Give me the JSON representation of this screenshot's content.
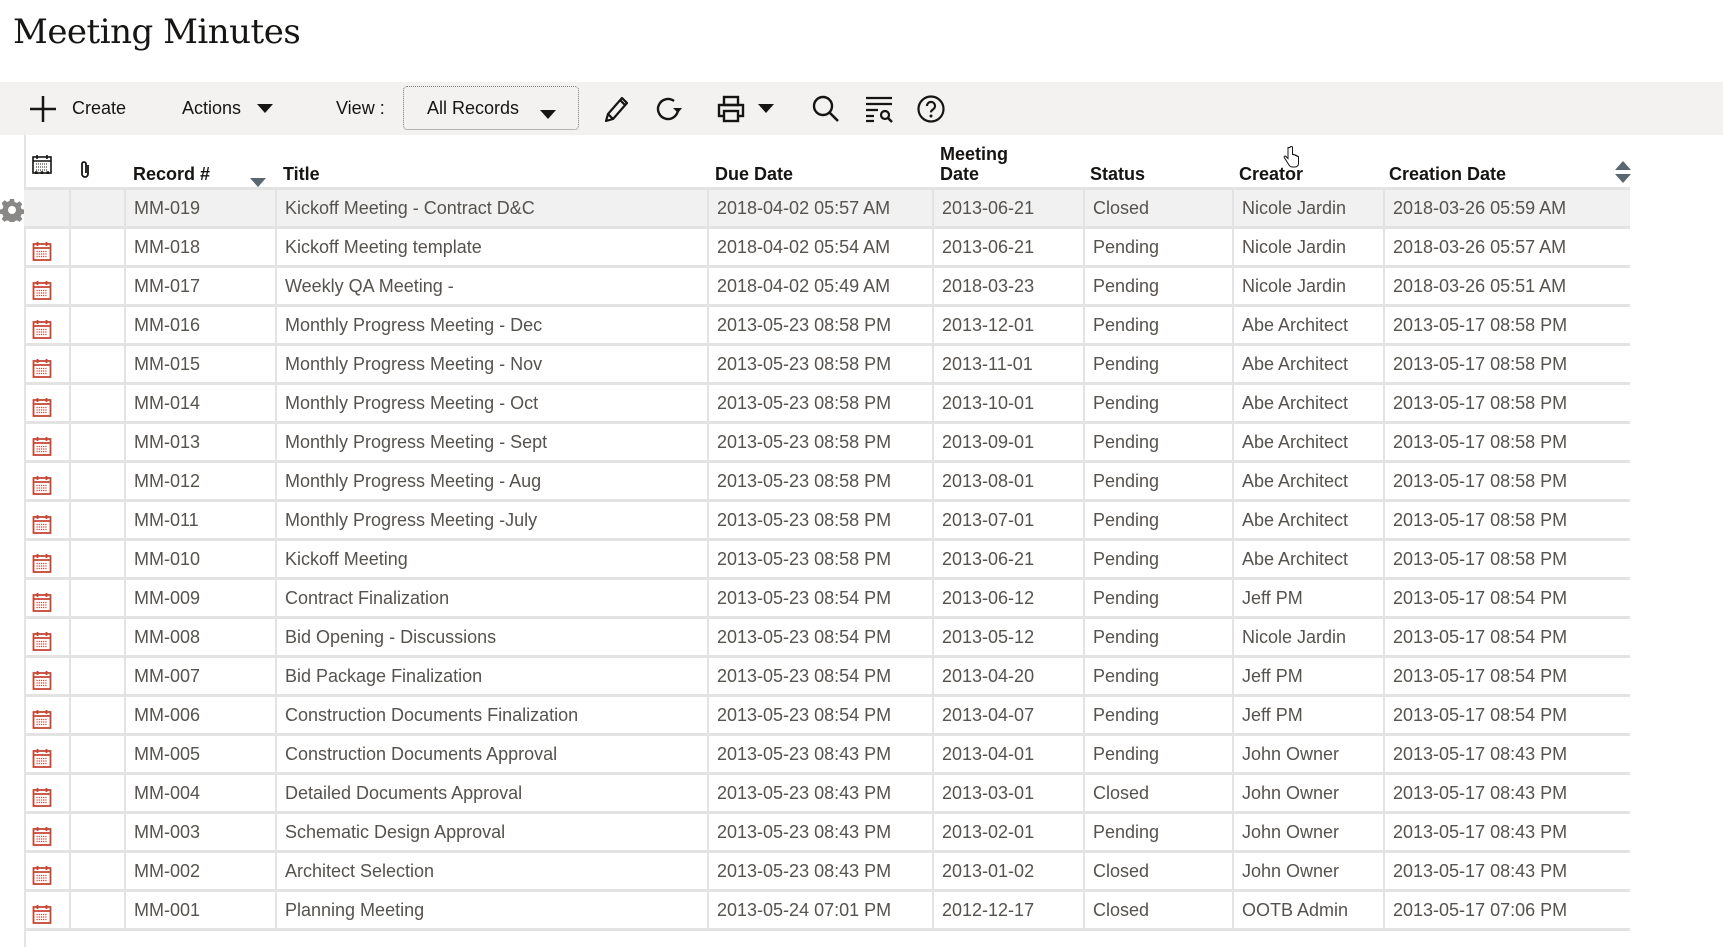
{
  "page": {
    "title": "Meeting Minutes"
  },
  "toolbar": {
    "create_label": "Create",
    "actions_label": "Actions",
    "view_label": "View :",
    "view_selected": "All Records",
    "icons": [
      "edit-icon",
      "refresh-icon",
      "print-icon",
      "search-icon",
      "find-icon",
      "help-icon"
    ]
  },
  "table": {
    "columns": {
      "icon": "…",
      "record": "Record #",
      "title": "Title",
      "due_date": "Due Date",
      "meeting_date_1": "Meeting",
      "meeting_date_2": "Date",
      "status": "Status",
      "creator": "Creator",
      "creation_date": "Creation Date"
    },
    "rows": [
      {
        "record": "MM-019",
        "title": "Kickoff Meeting - Contract D&C",
        "due": "2018-04-02 05:57 AM",
        "meeting": "2013-06-21",
        "status": "Closed",
        "creator": "Nicole Jardin",
        "created": "2018-03-26 05:59 AM",
        "icon": false,
        "selected": true
      },
      {
        "record": "MM-018",
        "title": "Kickoff Meeting template",
        "due": "2018-04-02 05:54 AM",
        "meeting": "2013-06-21",
        "status": "Pending",
        "creator": "Nicole Jardin",
        "created": "2018-03-26 05:57 AM",
        "icon": true
      },
      {
        "record": "MM-017",
        "title": "Weekly QA Meeting -",
        "due": "2018-04-02 05:49 AM",
        "meeting": "2018-03-23",
        "status": "Pending",
        "creator": "Nicole Jardin",
        "created": "2018-03-26 05:51 AM",
        "icon": true
      },
      {
        "record": "MM-016",
        "title": "Monthly Progress Meeting - Dec",
        "due": "2013-05-23 08:58 PM",
        "meeting": "2013-12-01",
        "status": "Pending",
        "creator": "Abe Architect",
        "created": "2013-05-17 08:58 PM",
        "icon": true
      },
      {
        "record": "MM-015",
        "title": "Monthly Progress Meeting - Nov",
        "due": "2013-05-23 08:58 PM",
        "meeting": "2013-11-01",
        "status": "Pending",
        "creator": "Abe Architect",
        "created": "2013-05-17 08:58 PM",
        "icon": true
      },
      {
        "record": "MM-014",
        "title": "Monthly Progress Meeting - Oct",
        "due": "2013-05-23 08:58 PM",
        "meeting": "2013-10-01",
        "status": "Pending",
        "creator": "Abe Architect",
        "created": "2013-05-17 08:58 PM",
        "icon": true
      },
      {
        "record": "MM-013",
        "title": "Monthly Progress Meeting - Sept",
        "due": "2013-05-23 08:58 PM",
        "meeting": "2013-09-01",
        "status": "Pending",
        "creator": "Abe Architect",
        "created": "2013-05-17 08:58 PM",
        "icon": true
      },
      {
        "record": "MM-012",
        "title": "Monthly Progress Meeting - Aug",
        "due": "2013-05-23 08:58 PM",
        "meeting": "2013-08-01",
        "status": "Pending",
        "creator": "Abe Architect",
        "created": "2013-05-17 08:58 PM",
        "icon": true
      },
      {
        "record": "MM-011",
        "title": "Monthly Progress Meeting -July",
        "due": "2013-05-23 08:58 PM",
        "meeting": "2013-07-01",
        "status": "Pending",
        "creator": "Abe Architect",
        "created": "2013-05-17 08:58 PM",
        "icon": true
      },
      {
        "record": "MM-010",
        "title": "Kickoff Meeting",
        "due": "2013-05-23 08:58 PM",
        "meeting": "2013-06-21",
        "status": "Pending",
        "creator": "Abe Architect",
        "created": "2013-05-17 08:58 PM",
        "icon": true
      },
      {
        "record": "MM-009",
        "title": "Contract Finalization",
        "due": "2013-05-23 08:54 PM",
        "meeting": "2013-06-12",
        "status": "Pending",
        "creator": "Jeff PM",
        "created": "2013-05-17 08:54 PM",
        "icon": true
      },
      {
        "record": "MM-008",
        "title": "Bid Opening - Discussions",
        "due": "2013-05-23 08:54 PM",
        "meeting": "2013-05-12",
        "status": "Pending",
        "creator": "Nicole Jardin",
        "created": "2013-05-17 08:54 PM",
        "icon": true
      },
      {
        "record": "MM-007",
        "title": "Bid Package Finalization",
        "due": "2013-05-23 08:54 PM",
        "meeting": "2013-04-20",
        "status": "Pending",
        "creator": "Jeff PM",
        "created": "2013-05-17 08:54 PM",
        "icon": true
      },
      {
        "record": "MM-006",
        "title": "Construction Documents Finalization",
        "due": "2013-05-23 08:54 PM",
        "meeting": "2013-04-07",
        "status": "Pending",
        "creator": "Jeff PM",
        "created": "2013-05-17 08:54 PM",
        "icon": true
      },
      {
        "record": "MM-005",
        "title": "Construction Documents Approval",
        "due": "2013-05-23 08:43 PM",
        "meeting": "2013-04-01",
        "status": "Pending",
        "creator": "John Owner",
        "created": "2013-05-17 08:43 PM",
        "icon": true
      },
      {
        "record": "MM-004",
        "title": "Detailed Documents Approval",
        "due": "2013-05-23 08:43 PM",
        "meeting": "2013-03-01",
        "status": "Closed",
        "creator": "John Owner",
        "created": "2013-05-17 08:43 PM",
        "icon": true
      },
      {
        "record": "MM-003",
        "title": "Schematic Design Approval",
        "due": "2013-05-23 08:43 PM",
        "meeting": "2013-02-01",
        "status": "Pending",
        "creator": "John Owner",
        "created": "2013-05-17 08:43 PM",
        "icon": true
      },
      {
        "record": "MM-002",
        "title": "Architect Selection",
        "due": "2013-05-23 08:43 PM",
        "meeting": "2013-01-02",
        "status": "Closed",
        "creator": "John Owner",
        "created": "2013-05-17 08:43 PM",
        "icon": true
      },
      {
        "record": "MM-001",
        "title": "Planning Meeting",
        "due": "2013-05-24 07:01 PM",
        "meeting": "2012-12-17",
        "status": "Closed",
        "creator": "OOTB Admin",
        "created": "2013-05-17 07:06 PM",
        "icon": true
      }
    ]
  },
  "colors": {
    "toolbar_bg": "#f3f2f1",
    "grid_line": "#e3e3e3",
    "icon_red": "#c74634",
    "selected_row": "#f1f1f1",
    "cell_text": "#56524e"
  }
}
